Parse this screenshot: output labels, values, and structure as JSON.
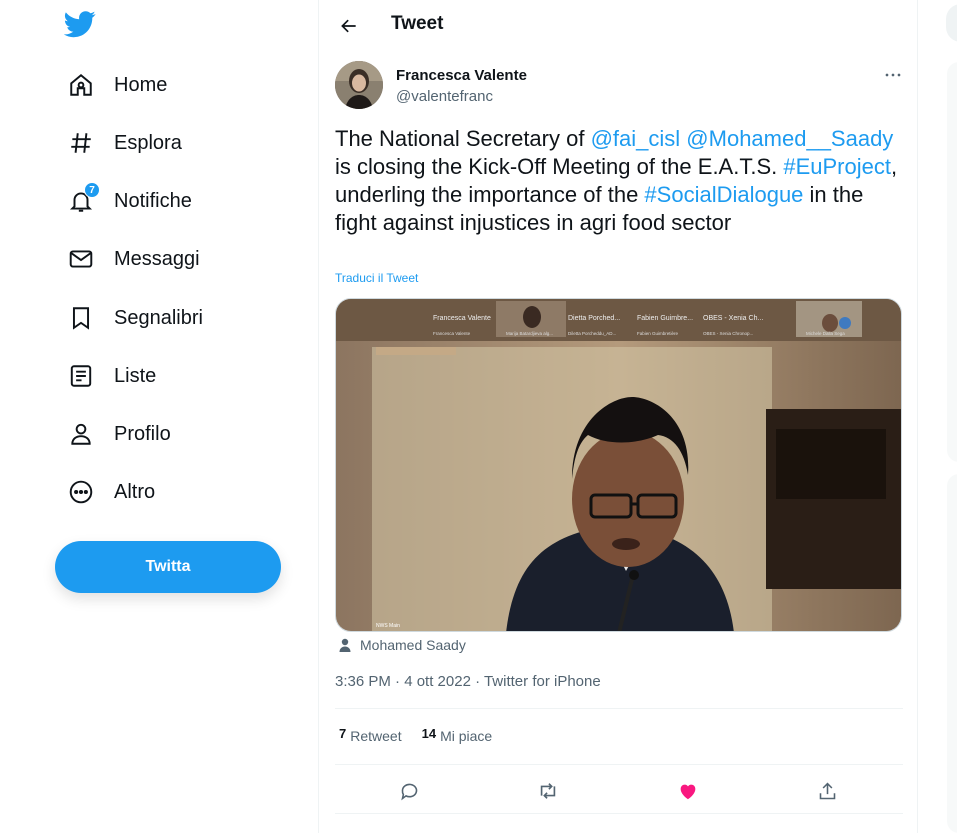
{
  "nav": {
    "items": [
      {
        "label": "Home",
        "icon": "home-icon"
      },
      {
        "label": "Esplora",
        "icon": "hashtag-icon"
      },
      {
        "label": "Notifiche",
        "icon": "bell-icon",
        "badge": "7"
      },
      {
        "label": "Messaggi",
        "icon": "envelope-icon"
      },
      {
        "label": "Segnalibri",
        "icon": "bookmark-icon"
      },
      {
        "label": "Liste",
        "icon": "list-icon"
      },
      {
        "label": "Profilo",
        "icon": "person-icon"
      },
      {
        "label": "Altro",
        "icon": "more-circle-icon"
      }
    ],
    "tweet_button": "Twitta"
  },
  "header": {
    "title": "Tweet"
  },
  "tweet": {
    "author_name": "Francesca Valente",
    "author_handle": "@valentefranc",
    "text": {
      "t1": "The National Secretary of ",
      "m1": "@fai_cisl",
      "sp1": " ",
      "m2": "@Mohamed__Saady",
      "t2": " is closing the Kick-Off Meeting of the E.A.T.S. ",
      "h1": "#EuProject",
      "t3": ", underling the importance of the ",
      "h2": "#SocialDialogue",
      "t4": " in the fight against injustices in agri food sector"
    },
    "translate": "Traduci il Tweet",
    "media": {
      "participants": [
        "Francesca Valente",
        "Dietta Porched...",
        "Fabien Guimbre...",
        "OBES - Xenia Ch..."
      ],
      "sublabels": [
        "Francesca Valente",
        "Marija Batardjieva alg...",
        "Diletta Porcheddu_AD...",
        "Fabien Guimbretière",
        "OBES - Xenia Chronop...",
        "Michele Dalla Sega"
      ],
      "caption": "NWS Main"
    },
    "tagged_user": "Mohamed Saady",
    "meta": "3:36 PM · 4 ott 2022 · Twitter for iPhone",
    "retweets_count": "7",
    "retweets_label": "Retweet",
    "likes_count": "14",
    "likes_label": "Mi piace"
  },
  "colors": {
    "accent": "#1d9bf0",
    "like": "#f91880",
    "text": "#0f1419",
    "secondary": "#536471"
  }
}
